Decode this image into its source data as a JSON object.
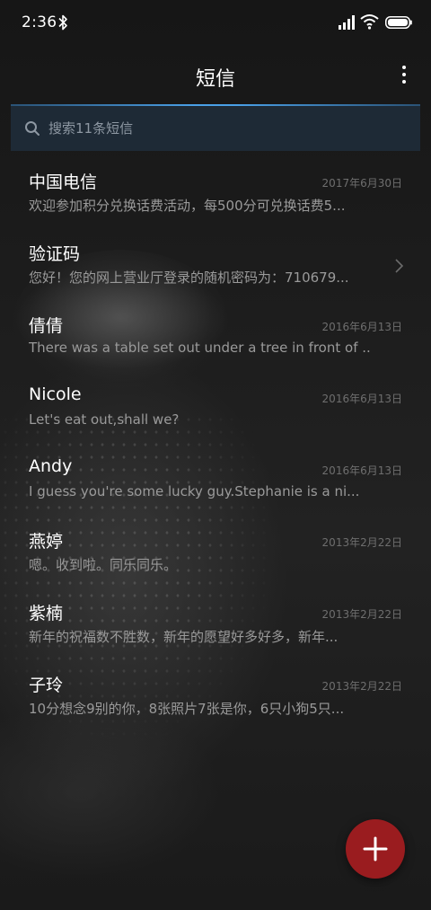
{
  "status_bar": {
    "time": "2:36",
    "icons": [
      "bluetooth-icon",
      "signal-icon",
      "wifi-icon",
      "battery-icon"
    ]
  },
  "header": {
    "title": "短信",
    "more_icon": "more-vertical-icon"
  },
  "search": {
    "placeholder": "搜索11条短信",
    "value": "",
    "icon": "search-icon"
  },
  "messages": [
    {
      "sender": "中国电信",
      "date": "2017年6月30日",
      "preview": "欢迎参加积分兑换话费活动，每500分可兑换话费5..."
    },
    {
      "sender": "验证码",
      "date": "",
      "preview": "您好！您的网上营业厅登录的随机密码为：710679...",
      "icon": "chevron-right-icon"
    },
    {
      "sender": "倩倩",
      "date": "2016年6月13日",
      "preview": "There was a table set out under a tree in front of ..."
    },
    {
      "sender": "Nicole",
      "date": "2016年6月13日",
      "preview": "Let's eat out,shall we?"
    },
    {
      "sender": "Andy",
      "date": "2016年6月13日",
      "preview": "I guess you're some lucky guy.Stephanie is a ni..."
    },
    {
      "sender": "燕婷",
      "date": "2013年2月22日",
      "preview": "嗯。收到啦。同乐同乐。"
    },
    {
      "sender": "紫楠",
      "date": "2013年2月22日",
      "preview": "新年的祝福数不胜数，新年的愿望好多好多，新年..."
    },
    {
      "sender": "子玲",
      "date": "2013年2月22日",
      "preview": "10分想念9别的你，8张照片7张是你，6只小狗5只..."
    }
  ],
  "fab": {
    "icon": "plus-icon"
  },
  "colors": {
    "accent": "#9a1c1f",
    "search_bg": "#1e2a36",
    "search_highlight": "#4aa0e8"
  }
}
